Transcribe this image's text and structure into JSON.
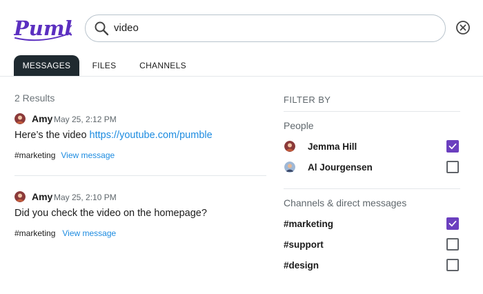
{
  "app": {
    "logo_text": "Pumble",
    "brand_color": "#5b2fc0"
  },
  "search": {
    "value": "video",
    "icon": "search-icon",
    "clear_icon": "clear-icon"
  },
  "tabs": [
    {
      "label": "MESSAGES",
      "active": true
    },
    {
      "label": "FILES",
      "active": false
    },
    {
      "label": "CHANNELS",
      "active": false
    }
  ],
  "results": {
    "count_label": "2 Results",
    "messages": [
      {
        "author": "Amy",
        "time": "May 25, 2:12 PM",
        "text": "Here’s the video ",
        "link": "https://youtube.com/pumble",
        "channel": "#marketing",
        "view_label": "View message"
      },
      {
        "author": "Amy",
        "time": "May 25, 2:10 PM",
        "text": "Did you check the video on the homepage?",
        "link": "",
        "channel": "#marketing",
        "view_label": "View message"
      }
    ]
  },
  "filter": {
    "title": "FILTER BY",
    "people_label": "People",
    "people": [
      {
        "name": "Jemma Hill",
        "checked": true
      },
      {
        "name": "Al Jourgensen",
        "checked": false
      }
    ],
    "channels_label": "Channels & direct messages",
    "channels": [
      {
        "name": "#marketing",
        "checked": true
      },
      {
        "name": "#support",
        "checked": false
      },
      {
        "name": "#design",
        "checked": false
      }
    ]
  },
  "colors": {
    "accent": "#6b3fbf",
    "link": "#1c8be0",
    "active_tab": "#1f2a30"
  }
}
